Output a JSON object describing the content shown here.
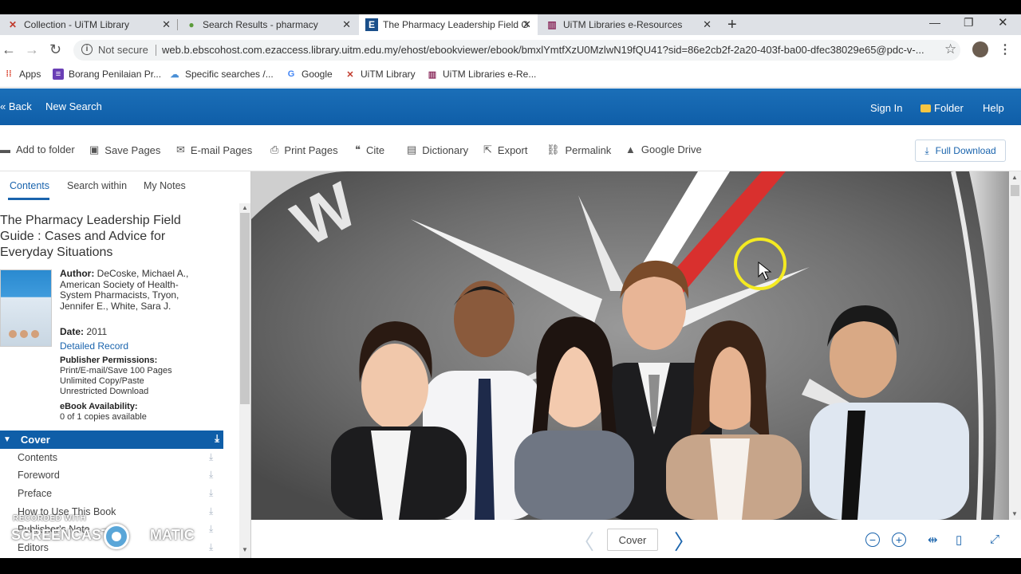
{
  "browser": {
    "tabs": [
      {
        "title": "Collection - UiTM Library",
        "icon": "uitm-x-icon"
      },
      {
        "title": "Search Results - pharmacy",
        "icon": "ebsco-search-icon"
      },
      {
        "title": "The Pharmacy Leadership Field G",
        "icon": "ebsco-e-icon",
        "active": true
      },
      {
        "title": "UiTM Libraries e-Resources",
        "icon": "uitm-library-icon"
      }
    ],
    "not_secure": "Not secure",
    "url": "web.b.ebscohost.com.ezaccess.library.uitm.edu.my/ehost/ebookviewer/ebook/bmxlYmtfXzU0MzlwN19fQU41?sid=86e2cb2f-2a20-403f-ba00-dfec38029e65@pdc-v-..."
  },
  "bookmarks": [
    {
      "label": "Apps"
    },
    {
      "label": "Borang Penilaian Pr..."
    },
    {
      "label": "Specific searches /..."
    },
    {
      "label": "Google"
    },
    {
      "label": "UiTM Library"
    },
    {
      "label": "UiTM Libraries e-Re..."
    }
  ],
  "header": {
    "back": "« Back",
    "new_search": "New Search",
    "sign_in": "Sign In",
    "folder": "Folder",
    "help": "Help"
  },
  "toolbar": {
    "add_to_folder": "Add to folder",
    "save_pages": "Save Pages",
    "email_pages": "E-mail Pages",
    "print_pages": "Print Pages",
    "cite": "Cite",
    "dictionary": "Dictionary",
    "export": "Export",
    "permalink": "Permalink",
    "google_drive": "Google Drive",
    "full_download": "Full Download"
  },
  "left_pane": {
    "tabs": [
      "Contents",
      "Search within",
      "My Notes"
    ],
    "title": "The Pharmacy Leadership Field Guide : Cases and Advice for Everyday Situations",
    "author_label": "Author:",
    "author": "DeCoske, Michael A., American Society of Health-System Pharmacists, Tryon, Jennifer E., White, Sara J.",
    "date_label": "Date:",
    "date": "2011",
    "detailed_record": "Detailed Record",
    "permissions_label": "Publisher Permissions:",
    "permissions": [
      "Print/E-mail/Save 100 Pages",
      "Unlimited Copy/Paste",
      "Unrestricted Download"
    ],
    "availability_label": "eBook Availability:",
    "availability": "0 of 1 copies available",
    "toc": [
      "Cover",
      "Contents",
      "Foreword",
      "Preface",
      "How to Use This Book",
      "Publisher's Note",
      "Editors"
    ]
  },
  "watermark": {
    "line1": "RECORDED WITH",
    "line2": "SCREENCAST",
    "line3": "MATIC"
  },
  "viewer": {
    "page_label": "Cover"
  }
}
